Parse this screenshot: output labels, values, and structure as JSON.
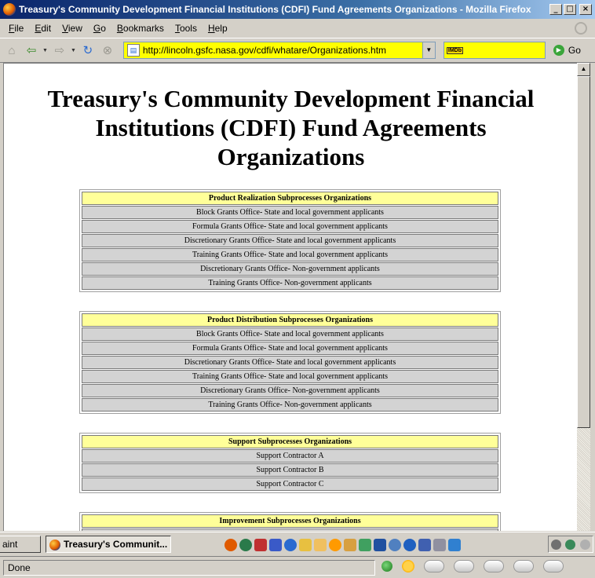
{
  "window": {
    "title": "Treasury's Community Development Financial Institutions (CDFI) Fund Agreements Organizations - Mozilla Firefox",
    "controls": {
      "minimize": "_",
      "maximize": "□",
      "close": "×"
    }
  },
  "menu": {
    "items": [
      {
        "access": "F",
        "rest": "ile"
      },
      {
        "access": "E",
        "rest": "dit"
      },
      {
        "access": "V",
        "rest": "iew"
      },
      {
        "access": "G",
        "rest": "o"
      },
      {
        "access": "B",
        "rest": "ookmarks"
      },
      {
        "access": "T",
        "rest": "ools"
      },
      {
        "access": "H",
        "rest": "elp"
      }
    ]
  },
  "toolbar": {
    "url": "http://lincoln.gsfc.nasa.gov/cdfi/whatare/Organizations.htm",
    "search_engine": "IMDb",
    "search_value": "",
    "go_label": "Go",
    "url_bar_color": "#ffff00"
  },
  "page": {
    "heading": "Treasury's Community Development Financial Institutions (CDFI) Fund Agreements Organizations",
    "tables": [
      {
        "header": "Product Realization Subprocesses Organizations",
        "rows": [
          "Block Grants Office- State and local government applicants",
          "Formula Grants Office- State and local government applicants",
          "Discretionary Grants Office- State and local government applicants",
          "Training Grants Office- State and local government applicants",
          "Discretionary Grants Office- Non-government applicants",
          "Training Grants Office- Non-government applicants"
        ]
      },
      {
        "header": "Product Distribution Subprocesses Organizations",
        "rows": [
          "Block Grants Office- State and local government applicants",
          "Formula Grants Office- State and local government applicants",
          "Discretionary Grants Office- State and local government applicants",
          "Training Grants Office- State and local government applicants",
          "Discretionary Grants Office- Non-government applicants",
          "Training Grants Office- Non-government applicants"
        ]
      },
      {
        "header": "Support Subprocesses Organizations",
        "rows": [
          "Support Contractor A",
          "Support Contractor B",
          "Support Contractor C"
        ]
      },
      {
        "header": "Improvement Subprocesses Organizations",
        "rows": []
      }
    ],
    "header_row_color": "#ffff99",
    "body_row_color": "#d3d3d3"
  },
  "taskbar": {
    "tasks": [
      {
        "label": "aint",
        "active": false
      },
      {
        "label": "Treasury's Communit...",
        "active": true
      }
    ]
  },
  "status": {
    "text": "Done"
  }
}
